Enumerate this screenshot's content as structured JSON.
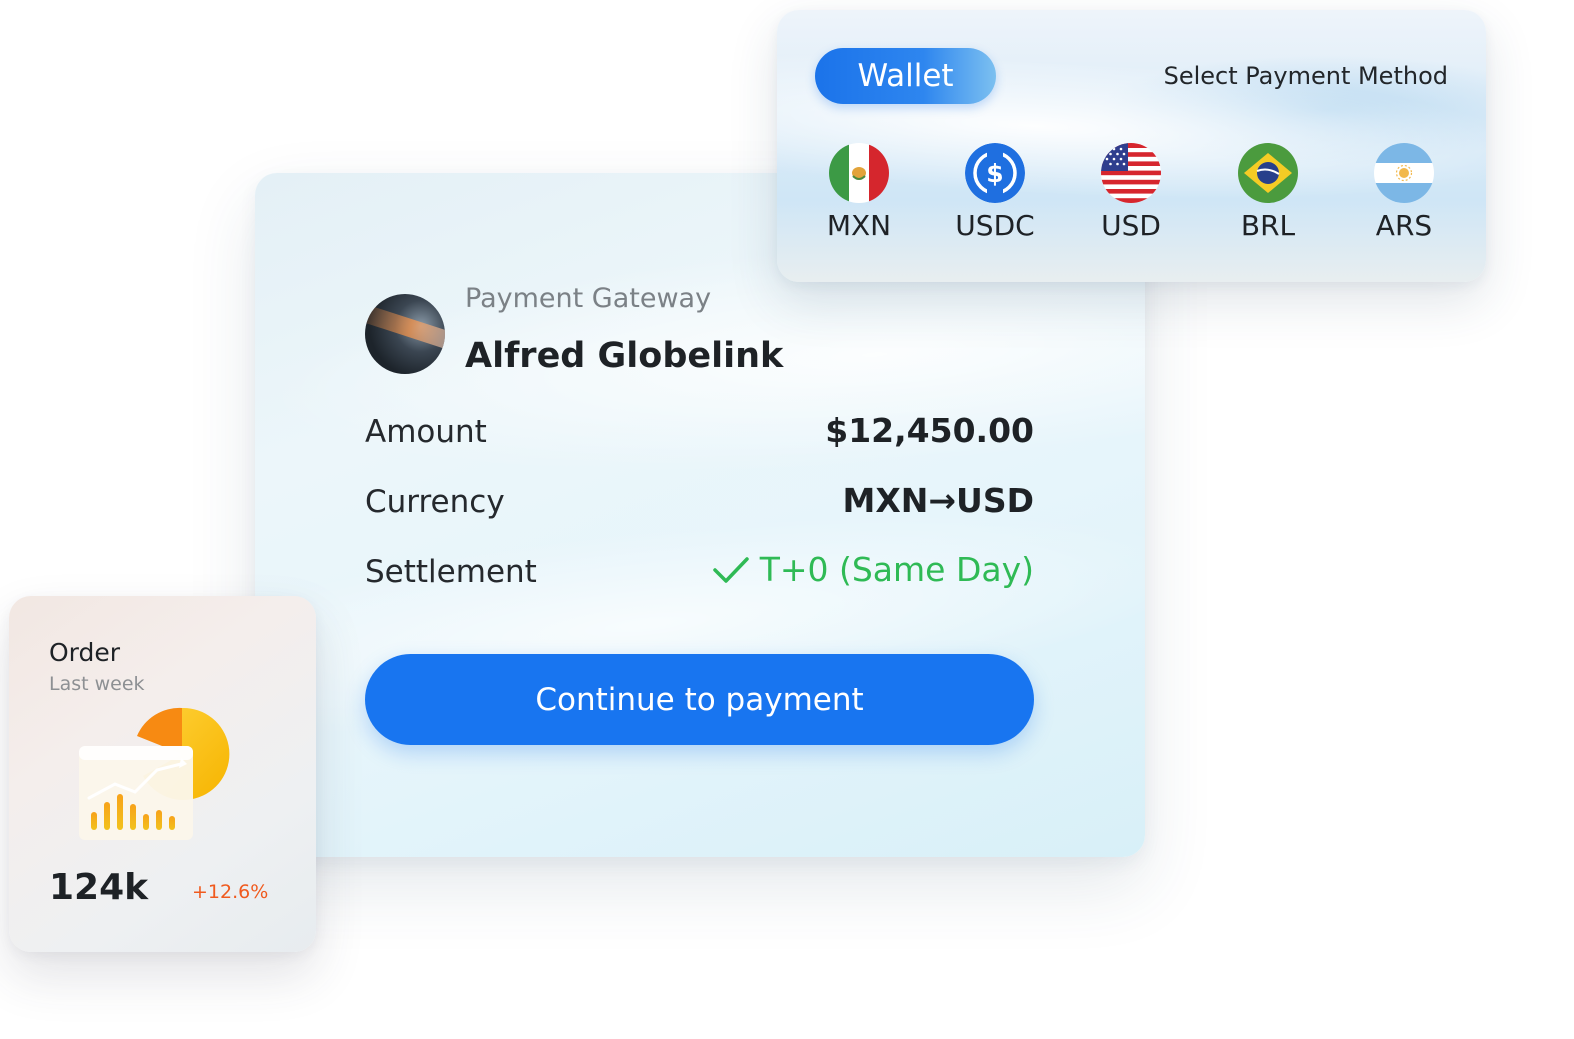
{
  "wallet": {
    "tab_label": "Wallet",
    "select_label": "Select Payment Method",
    "currencies": [
      {
        "code": "MXN",
        "icon": "mexico-flag-icon"
      },
      {
        "code": "USDC",
        "icon": "usdc-coin-icon"
      },
      {
        "code": "USD",
        "icon": "usa-flag-icon"
      },
      {
        "code": "BRL",
        "icon": "brazil-flag-icon"
      },
      {
        "code": "ARS",
        "icon": "argentina-flag-icon"
      }
    ]
  },
  "payment": {
    "gateway_label": "Payment Gateway",
    "merchant_name": "Alfred Globelink",
    "rows": {
      "amount_label": "Amount",
      "amount_value": "$12,450.00",
      "currency_label": "Currency",
      "currency_value": "MXN→USD",
      "settlement_label": "Settlement",
      "settlement_value": "T+0 (Same Day)"
    },
    "continue_label": "Continue to payment"
  },
  "order": {
    "title": "Order",
    "subtitle": "Last week",
    "value": "124k",
    "change": "+12.6%"
  },
  "colors": {
    "accent": "#1875f0",
    "success": "#2fba55",
    "change": "#f05a1e"
  }
}
